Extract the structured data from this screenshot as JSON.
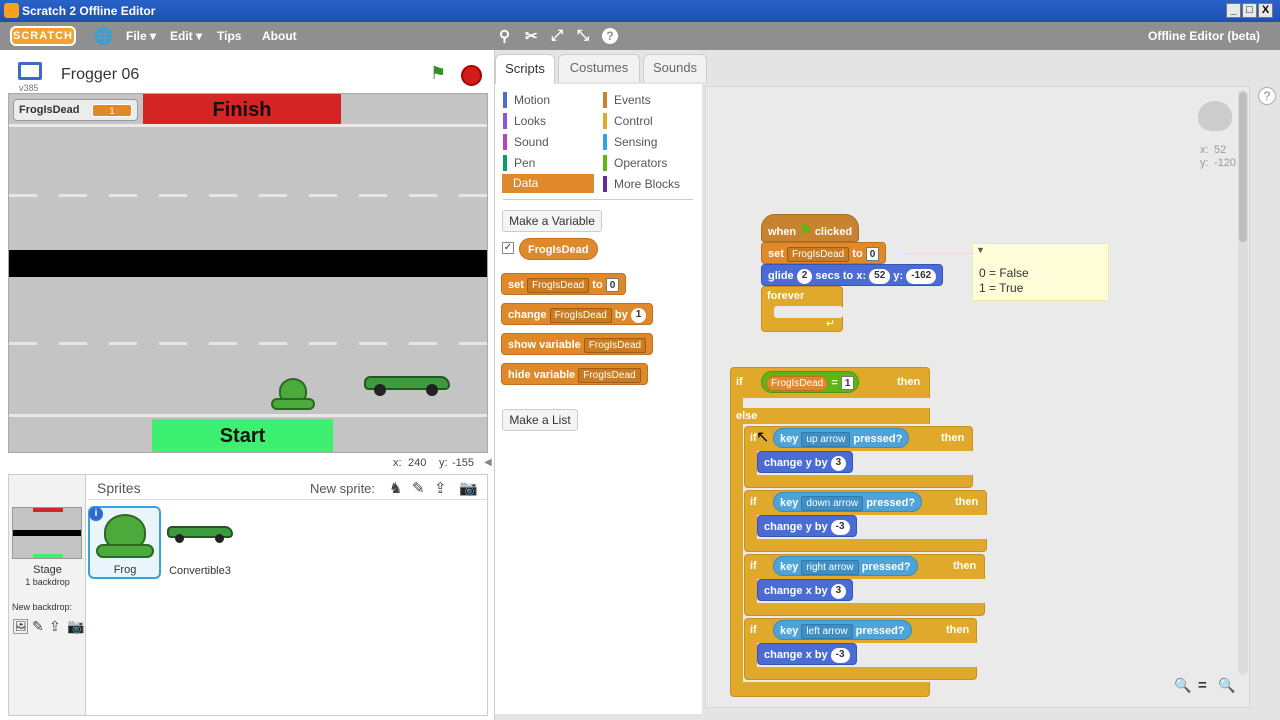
{
  "window": {
    "title": "Scratch 2 Offline Editor",
    "min": "_",
    "max": "□",
    "close": "X"
  },
  "menu": {
    "logo": "SCRATCH",
    "file": "File ▾",
    "edit": "Edit ▾",
    "tips": "Tips",
    "about": "About",
    "edition": "Offline Editor (beta)"
  },
  "stage": {
    "project_title": "Frogger 06",
    "version": "v385",
    "var_name": "FrogIsDead",
    "var_value": "1",
    "finish_label": "Finish",
    "start_label": "Start",
    "coords_x_label": "x:",
    "coords_x": "240",
    "coords_y_label": "y:",
    "coords_y": "-155"
  },
  "sprites": {
    "header": "Sprites",
    "new_sprite": "New sprite:",
    "stage_label": "Stage",
    "stage_sub": "1 backdrop",
    "new_backdrop": "New backdrop:",
    "items": [
      {
        "name": "Frog"
      },
      {
        "name": "Convertible3"
      }
    ]
  },
  "tabs": {
    "scripts": "Scripts",
    "costumes": "Costumes",
    "sounds": "Sounds"
  },
  "categories": {
    "motion": "Motion",
    "looks": "Looks",
    "sound": "Sound",
    "pen": "Pen",
    "data": "Data",
    "events": "Events",
    "control": "Control",
    "sensing": "Sensing",
    "operators": "Operators",
    "more": "More Blocks",
    "colors": {
      "motion": "#4a6cd4",
      "looks": "#8a55d7",
      "sound": "#bb42c3",
      "pen": "#0e9a6c",
      "data": "#e0892b",
      "events": "#c88330",
      "control": "#e1a92b",
      "sensing": "#2ca5e2",
      "operators": "#5cb712",
      "more": "#632d99"
    }
  },
  "palette": {
    "make_var": "Make a Variable",
    "var_reporter": "FrogIsDead",
    "set": "set",
    "to": "to",
    "set_val": "0",
    "change": "change",
    "by": "by",
    "change_val": "1",
    "show": "show variable",
    "hide": "hide variable",
    "make_list": "Make a List"
  },
  "sprite_info": {
    "x_label": "x:",
    "x": "52",
    "y_label": "y:",
    "y": "-120"
  },
  "script": {
    "when": "when",
    "clicked": "clicked",
    "set": "set",
    "var": "FrogIsDead",
    "to": "to",
    "set_val": "0",
    "glide": "glide",
    "secs": "2",
    "secs_label": "secs to x:",
    "gx": "52",
    "y_label": "y:",
    "gy": "-162",
    "forever": "forever",
    "if": "if",
    "then": "then",
    "else": "else",
    "eq": "=",
    "eq_val": "1",
    "key": "key",
    "pressed": "pressed?",
    "change_y": "change y by",
    "change_x": "change x by",
    "k1": "up arrow",
    "v1": "3",
    "k2": "down arrow",
    "v2": "-3",
    "k3": "right arrow",
    "v3": "3",
    "k4": "left arrow",
    "v4": "-3"
  },
  "comment": {
    "line1": "0 = False",
    "line2": "1 = True"
  }
}
